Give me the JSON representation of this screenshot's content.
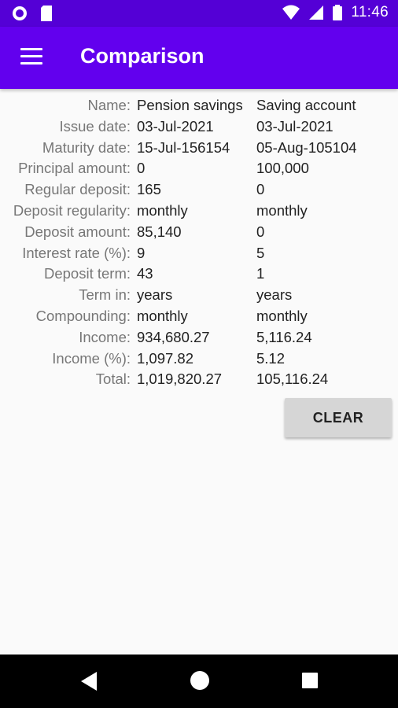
{
  "status": {
    "time": "11:46"
  },
  "app_bar": {
    "title": "Comparison"
  },
  "rows": [
    {
      "label": "Name:",
      "a": "Pension savings",
      "b": "Saving account"
    },
    {
      "label": "Issue date:",
      "a": "03-Jul-2021",
      "b": "03-Jul-2021"
    },
    {
      "label": "Maturity date:",
      "a": "15-Jul-156154",
      "b": "05-Aug-105104"
    },
    {
      "label": "Principal amount:",
      "a": "0",
      "b": "100,000"
    },
    {
      "label": "Regular deposit:",
      "a": "165",
      "b": "0"
    },
    {
      "label": "Deposit regularity:",
      "a": "monthly",
      "b": "monthly"
    },
    {
      "label": "Deposit amount:",
      "a": "85,140",
      "b": "0"
    },
    {
      "label": "Interest rate (%):",
      "a": "9",
      "b": "5"
    },
    {
      "label": "Deposit term:",
      "a": "43",
      "b": "1"
    },
    {
      "label": "Term in:",
      "a": "years",
      "b": "years"
    },
    {
      "label": "Compounding:",
      "a": "monthly",
      "b": "monthly"
    },
    {
      "label": "Income:",
      "a": "934,680.27",
      "b": "5,116.24"
    },
    {
      "label": "Income (%):",
      "a": "1,097.82",
      "b": "5.12"
    },
    {
      "label": "Total:",
      "a": "1,019,820.27",
      "b": "105,116.24"
    }
  ],
  "actions": {
    "clear_label": "CLEAR"
  },
  "colors": {
    "status_bar": "#5400d6",
    "app_bar": "#6200ee",
    "label_text": "#777777",
    "value_text": "#222222",
    "button_bg": "#d6d6d6"
  },
  "icons": [
    "radio-icon",
    "sim-card-icon",
    "wifi-icon",
    "signal-icon",
    "battery-icon",
    "menu-icon",
    "back-icon",
    "home-icon",
    "recents-icon"
  ]
}
